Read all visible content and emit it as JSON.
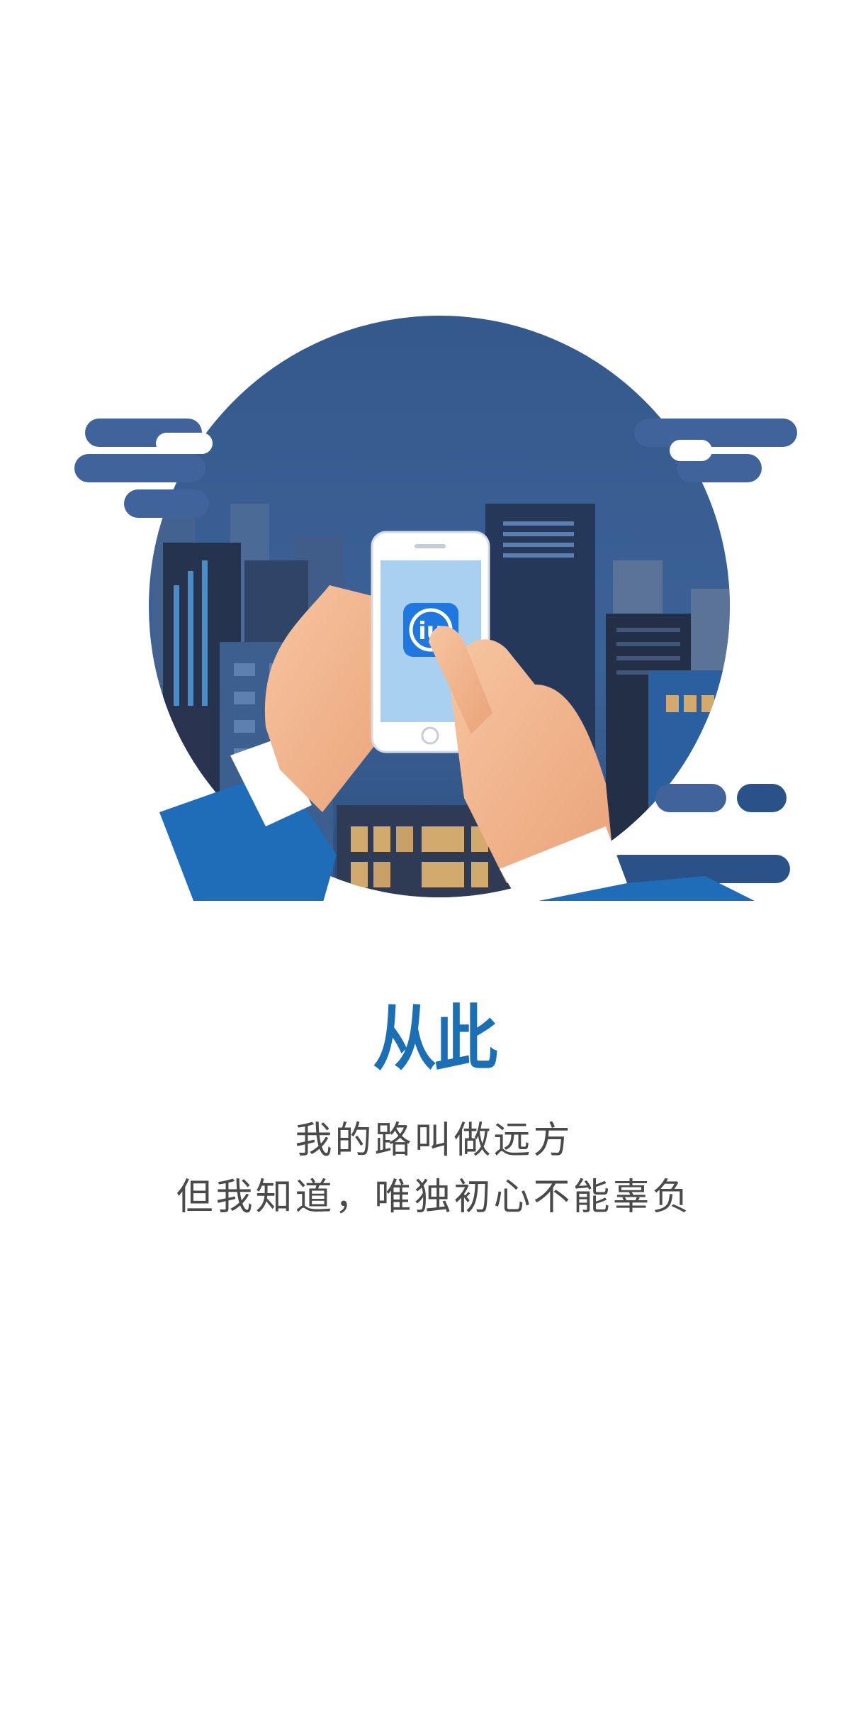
{
  "splash": {
    "headline": "从此",
    "tagline_line1": "我的路叫做远方",
    "tagline_line2": "但我知道，唯独初心不能辜负"
  },
  "illustration": {
    "subject": "hands-holding-phone-city-skyline",
    "app_icon": "app-logo-icon"
  },
  "colors": {
    "headline": "#1a6fb5",
    "sky": "#3a5f93",
    "cloud": "#3f639a",
    "phone_screen": "#a9d0f0",
    "app_icon_bg": "#1e78e0",
    "sleeve": "#1f6cb8",
    "skin": "#f3b58e",
    "tagline": "#4a4a4a"
  }
}
